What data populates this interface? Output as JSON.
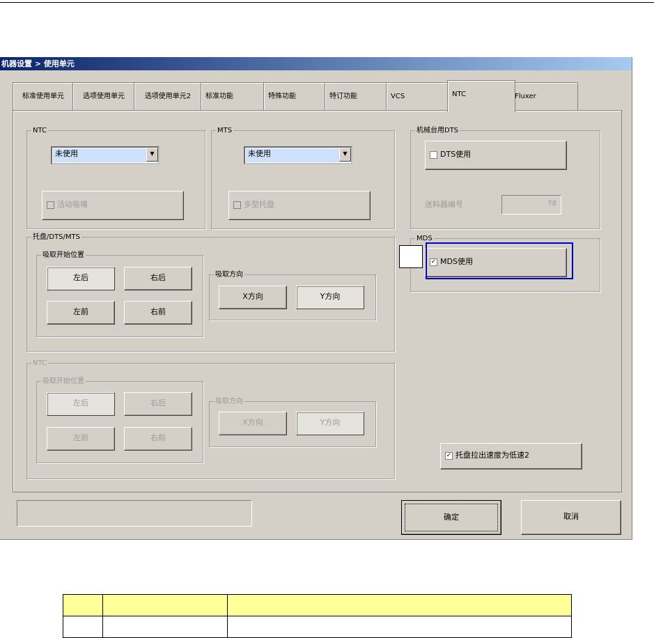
{
  "window": {
    "title": "机器设置 > 使用单元"
  },
  "tabs": [
    {
      "label": "标准使用单元"
    },
    {
      "label": "选项使用单元"
    },
    {
      "label": "选项使用单元2"
    },
    {
      "label": "标准功能"
    },
    {
      "label": "特殊功能"
    },
    {
      "label": "特订功能"
    },
    {
      "label": "VCS"
    },
    {
      "label": "NTC"
    },
    {
      "label": "Fluxer"
    }
  ],
  "ntc_group": {
    "label": "NTC",
    "select_value": "未使用",
    "checkbox_label": "活动吸嘴"
  },
  "mts_group": {
    "label": "MTS",
    "select_value": "未使用",
    "checkbox_label": "多型托盘"
  },
  "dts_group": {
    "label": "机械台用DTS",
    "checkbox_label": "DTS使用",
    "feeder_label": "送料器编号",
    "feeder_value": "78"
  },
  "mds_group": {
    "label": "MDS",
    "checkbox_label": "MDS使用"
  },
  "tray_group": {
    "label": "托盘/DTS/MTS",
    "start_label": "吸取开始位置",
    "buttons": [
      "左后",
      "右后",
      "左前",
      "右前"
    ],
    "dir_label": "吸取方向",
    "dir_buttons": [
      "X方向",
      "Y方向"
    ]
  },
  "ntc2_group": {
    "label": "NTC",
    "start_label": "吸取开始位置",
    "buttons": [
      "左后",
      "右后",
      "左前",
      "右前"
    ],
    "dir_label": "吸取方向",
    "dir_buttons": [
      "X方向",
      "Y方向"
    ]
  },
  "speed_checkbox": {
    "label": "托盘拉出速度为低速2"
  },
  "actions": {
    "ok": "确定",
    "cancel": "取消"
  },
  "checkmark": "✓",
  "combo_arrow": "▼"
}
